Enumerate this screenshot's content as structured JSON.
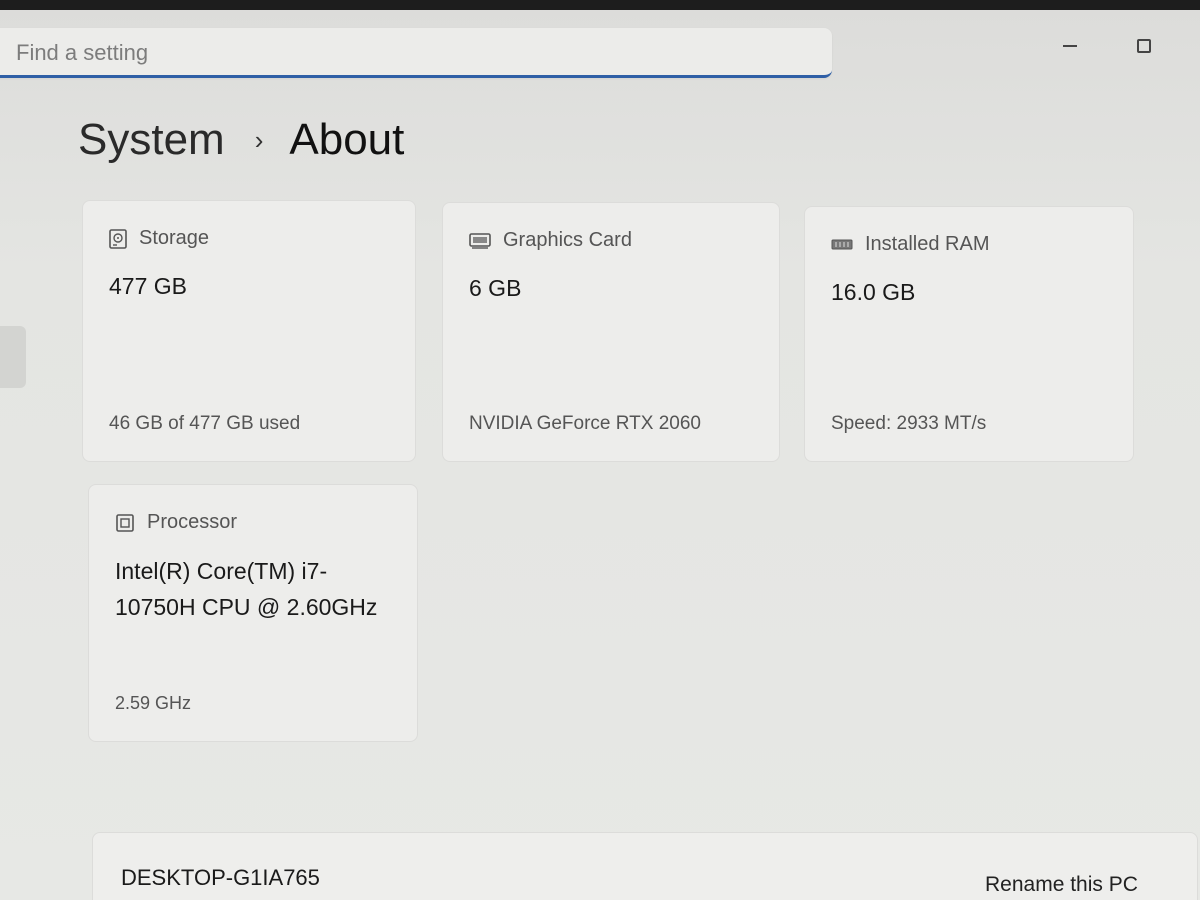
{
  "search": {
    "placeholder": "Find a setting"
  },
  "breadcrumb": {
    "parent": "System",
    "separator": "›",
    "current": "About"
  },
  "cards": {
    "storage": {
      "label": "Storage",
      "value": "477 GB",
      "detail": "46 GB of 477 GB used"
    },
    "graphics": {
      "label": "Graphics Card",
      "value": "6 GB",
      "detail": "NVIDIA GeForce RTX 2060"
    },
    "ram": {
      "label": "Installed RAM",
      "value": "16.0 GB",
      "detail": "Speed: 2933 MT/s"
    },
    "processor": {
      "label": "Processor",
      "value": "Intel(R) Core(TM) i7-10750H CPU @ 2.60GHz",
      "detail": "2.59 GHz"
    }
  },
  "device": {
    "name": "DESKTOP-G1IA765",
    "rename_label": "Rename this PC"
  },
  "icons": {
    "storage": "storage-icon",
    "graphics": "graphics-card-icon",
    "ram": "ram-icon",
    "processor": "processor-icon",
    "minimize": "minimize-icon",
    "maximize": "maximize-icon"
  },
  "colors": {
    "accent": "#2f5fa6",
    "background": "#e6e7e5",
    "card": "#ededeb"
  }
}
